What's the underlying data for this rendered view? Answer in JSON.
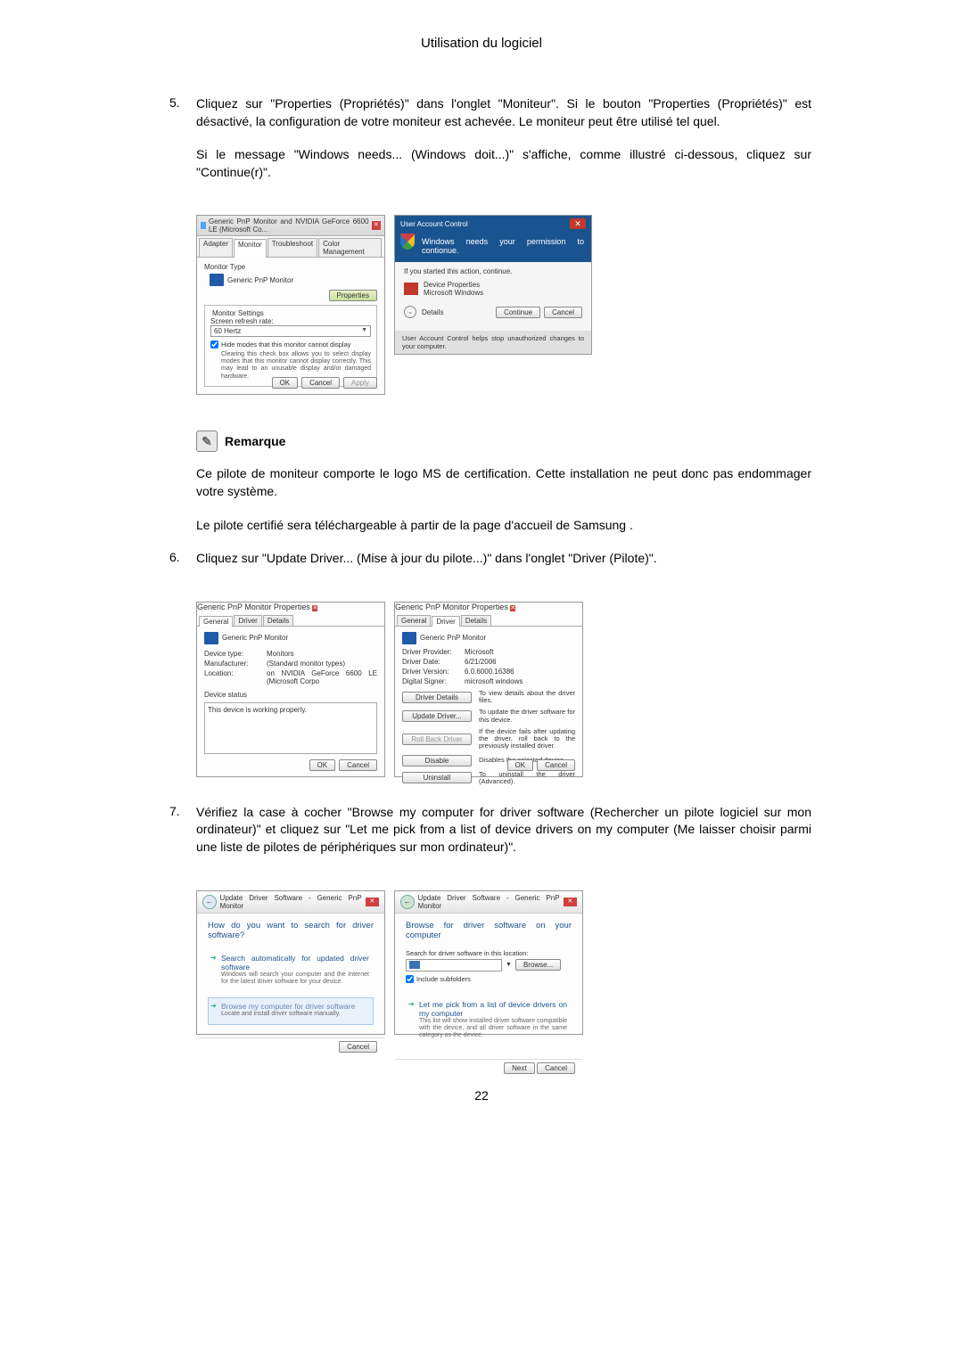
{
  "page": {
    "header": "Utilisation du logiciel",
    "page_number": "22"
  },
  "step5": {
    "number": "5.",
    "text1": "Cliquez sur \"Properties (Propriétés)\" dans l'onglet \"Moniteur\". Si le bouton \"Properties (Propriétés)\" est désactivé, la configuration de votre moniteur est achevée. Le moniteur peut être utilisé tel quel.",
    "text2": "Si le message \"Windows needs... (Windows doit...)\" s'affiche, comme illustré ci-dessous, cliquez sur \"Continue(r)\"."
  },
  "dialog_monitor_tab": {
    "title": "Generic PnP Monitor and NVIDIA GeForce 6600 LE (Microsoft Co...",
    "tab_adapter": "Adapter",
    "tab_monitor": "Monitor",
    "tab_troubleshoot": "Troubleshoot",
    "tab_color": "Color Management",
    "monitor_type_label": "Monitor Type",
    "monitor_name": "Generic PnP Monitor",
    "properties_btn": "Properties",
    "settings_label": "Monitor Settings",
    "refresh_label": "Screen refresh rate:",
    "refresh_value": "60 Hertz",
    "hide_modes_check": "Hide modes that this monitor cannot display",
    "hide_modes_desc": "Clearing this check box allows you to select display modes that this monitor cannot display correctly. This may lead to an unusable display and/or damaged hardware.",
    "ok": "OK",
    "cancel": "Cancel",
    "apply": "Apply"
  },
  "dialog_uac": {
    "title": "User Account Control",
    "message": "Windows needs your permission to contionue.",
    "subtext": "If you started this action, continue.",
    "app_name": "Device Properties",
    "app_publisher": "Microsoft Windows",
    "details": "Details",
    "continue": "Continue",
    "cancel": "Cancel",
    "footer": "User Account Control helps stop unauthorized changes to your computer."
  },
  "remarque": {
    "heading": "Remarque",
    "text1": "Ce pilote de moniteur comporte le logo MS de certification. Cette installation ne peut donc pas endommager votre système.",
    "text2": "Le pilote certifié sera téléchargeable à partir de la page d'accueil de Samsung ."
  },
  "step6": {
    "number": "6.",
    "text": "Cliquez sur \"Update Driver... (Mise à jour du pilote...)\" dans l'onglet \"Driver (Pilote)\"."
  },
  "dialog_general": {
    "title": "Generic PnP Monitor Properties",
    "tab_general": "General",
    "tab_driver": "Driver",
    "tab_details": "Details",
    "device_name": "Generic PnP Monitor",
    "device_type_lbl": "Device type:",
    "device_type_val": "Monitors",
    "manufacturer_lbl": "Manufacturer:",
    "manufacturer_val": "(Standard monitor types)",
    "location_lbl": "Location:",
    "location_val": "on NVIDIA GeForce 6600 LE (Microsoft Corpo",
    "status_lbl": "Device status",
    "status_val": "This device is working properly.",
    "ok": "OK",
    "cancel": "Cancel"
  },
  "dialog_driver": {
    "title": "Generic PnP Monitor Properties",
    "tab_general": "General",
    "tab_driver": "Driver",
    "tab_details": "Details",
    "device_name": "Generic PnP Monitor",
    "provider_lbl": "Driver Provider:",
    "provider_val": "Microsoft",
    "date_lbl": "Driver Date:",
    "date_val": "6/21/2006",
    "version_lbl": "Driver Version:",
    "version_val": "6.0.6000.16386",
    "signer_lbl": "Digital Signer:",
    "signer_val": "microsoft windows",
    "btn_details": "Driver Details",
    "desc_details": "To view details about the driver files.",
    "btn_update": "Update Driver...",
    "desc_update": "To update the driver software for this device.",
    "btn_rollback": "Roll Back Driver",
    "desc_rollback": "If the device fails after updating the driver, roll back to the previously installed driver.",
    "btn_disable": "Disable",
    "desc_disable": "Disables the selected device.",
    "btn_uninstall": "Uninstall",
    "desc_uninstall": "To uninstall the driver (Advanced).",
    "ok": "OK",
    "cancel": "Cancel"
  },
  "step7": {
    "number": "7.",
    "text": "Vérifiez la case à cocher \"Browse my computer for driver software (Rechercher un pilote logiciel sur mon ordinateur)\" et cliquez sur \"Let me pick from a list of device drivers on my computer (Me laisser choisir parmi une liste de pilotes de périphériques sur mon ordinateur)\"."
  },
  "dialog_wizard1": {
    "breadcrumb": "Update Driver Software - Generic PnP Monitor",
    "heading": "How do you want to search for driver software?",
    "opt1_title": "Search automatically for updated driver software",
    "opt1_desc": "Windows will search your computer and the Internet for the latest driver software for your device.",
    "opt2_title": "Browse my computer for driver software",
    "opt2_desc": "Locate and install driver software manually.",
    "cancel": "Cancel"
  },
  "dialog_wizard2": {
    "breadcrumb": "Update Driver Software - Generic PnP Monitor",
    "heading": "Browse for driver software on your computer",
    "search_label": "Search for driver software in this location:",
    "browse_btn": "Browse...",
    "include_sub": "Include subfolders",
    "pick_title": "Let me pick from a list of device drivers on my computer",
    "pick_desc": "This list will show installed driver software compatible with the device, and all driver software in the same category as the device.",
    "next": "Next",
    "cancel": "Cancel"
  }
}
